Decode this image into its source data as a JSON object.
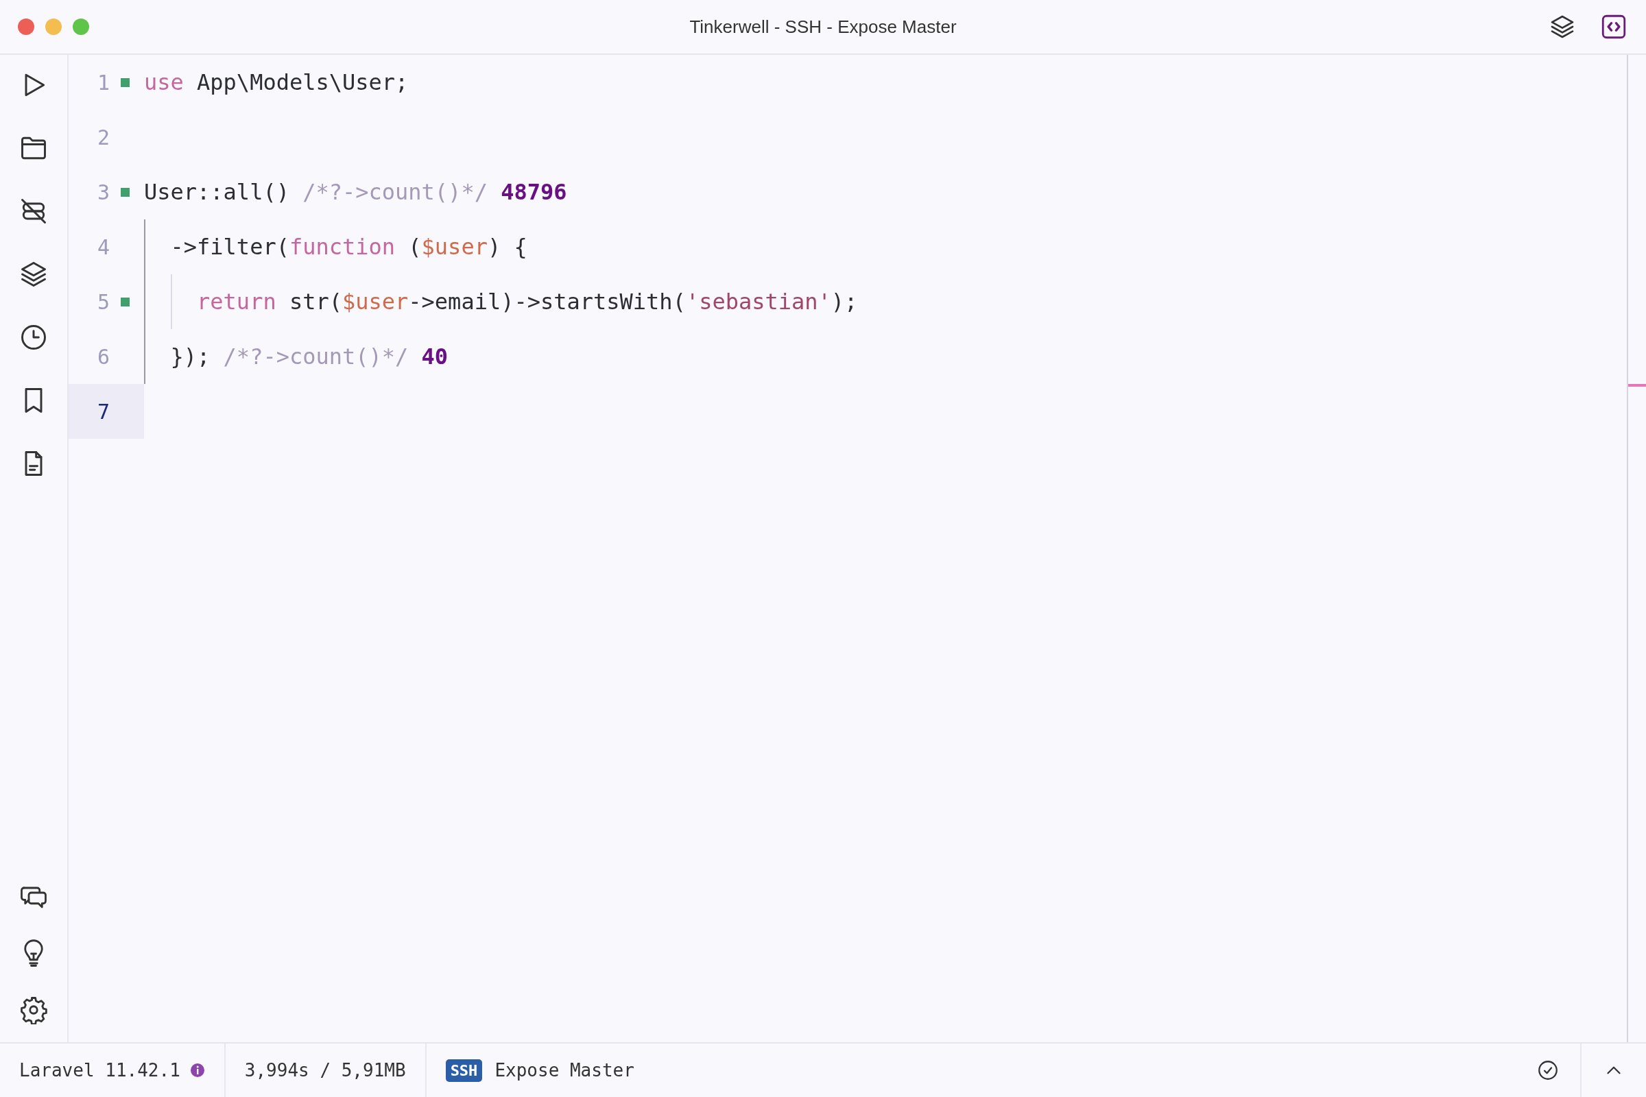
{
  "window": {
    "title": "Tinkerwell - SSH - Expose Master"
  },
  "editor": {
    "lines": [
      {
        "number": "1",
        "marker": true,
        "current": false,
        "tokens": [
          {
            "kind": "keyword",
            "text": "use"
          },
          {
            "kind": "plain",
            "text": " App\\Models\\User;"
          }
        ]
      },
      {
        "number": "2",
        "marker": false,
        "current": false
      },
      {
        "number": "3",
        "marker": true,
        "current": false,
        "tokens": [
          {
            "kind": "plain",
            "text": "User::all() "
          },
          {
            "kind": "comment",
            "text": "/*?->count()*/ "
          },
          {
            "kind": "result",
            "text": "48796"
          }
        ]
      },
      {
        "number": "4",
        "marker": false,
        "current": false,
        "tokens": [
          {
            "kind": "plain",
            "text": "  ->filter("
          },
          {
            "kind": "keyword",
            "text": "function"
          },
          {
            "kind": "plain",
            "text": " ("
          },
          {
            "kind": "variable",
            "text": "$user"
          },
          {
            "kind": "plain",
            "text": ") {"
          }
        ]
      },
      {
        "number": "5",
        "marker": true,
        "current": false,
        "tokens": [
          {
            "kind": "keyword",
            "text": "    return"
          },
          {
            "kind": "plain",
            "text": " str("
          },
          {
            "kind": "variable",
            "text": "$user"
          },
          {
            "kind": "plain",
            "text": "->email)->startsWith("
          },
          {
            "kind": "string",
            "text": "'sebastian'"
          },
          {
            "kind": "plain",
            "text": ");"
          }
        ]
      },
      {
        "number": "6",
        "marker": false,
        "current": false,
        "tokens": [
          {
            "kind": "plain",
            "text": "  }); "
          },
          {
            "kind": "comment",
            "text": "/*?->count()*/ "
          },
          {
            "kind": "result",
            "text": "40"
          }
        ]
      },
      {
        "number": "7",
        "marker": false,
        "current": true
      }
    ]
  },
  "status_bar": {
    "framework": "Laravel 11.42.1",
    "stats": "3,994s / 5,91MB",
    "connection_badge": "SSH",
    "connection_name": "Expose Master"
  }
}
